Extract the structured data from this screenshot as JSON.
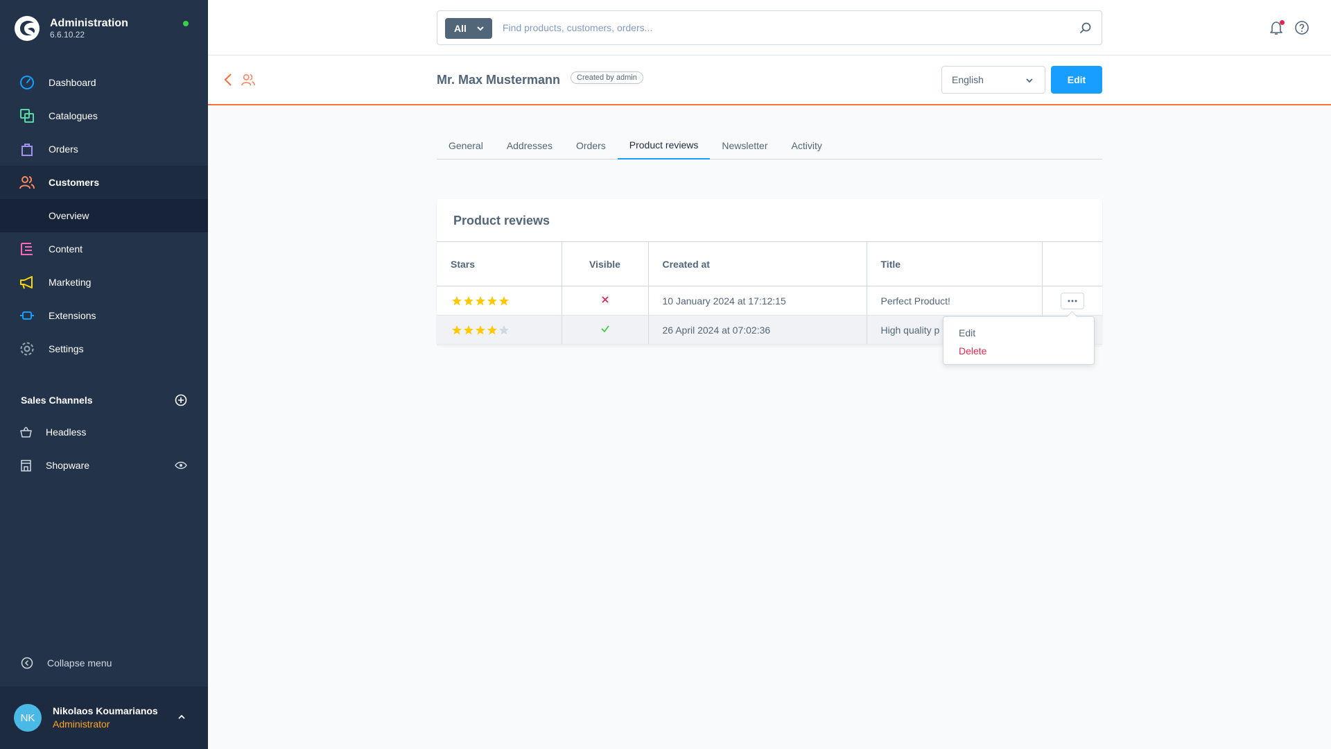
{
  "sidebar": {
    "app_title": "Administration",
    "version": "6.6.10.22",
    "items": [
      {
        "label": "Dashboard",
        "icon": "dashboard-icon"
      },
      {
        "label": "Catalogues",
        "icon": "catalogue-icon"
      },
      {
        "label": "Orders",
        "icon": "orders-icon"
      },
      {
        "label": "Customers",
        "icon": "customers-icon",
        "active": true
      },
      {
        "label": "Content",
        "icon": "content-icon"
      },
      {
        "label": "Marketing",
        "icon": "marketing-icon"
      },
      {
        "label": "Extensions",
        "icon": "extensions-icon"
      },
      {
        "label": "Settings",
        "icon": "settings-icon"
      }
    ],
    "subitem": "Overview",
    "sales_channels": {
      "title": "Sales Channels",
      "items": [
        {
          "label": "Headless",
          "icon": "basket-icon"
        },
        {
          "label": "Shopware",
          "icon": "storefront-icon"
        }
      ]
    },
    "collapse_label": "Collapse menu",
    "user": {
      "initials": "NK",
      "name": "Nikolaos Koumarianos",
      "role": "Administrator"
    }
  },
  "search": {
    "scope": "All",
    "placeholder": "Find products, customers, orders..."
  },
  "header": {
    "title": "Mr. Max Mustermann",
    "badge": "Created by admin",
    "language": "English",
    "edit_label": "Edit"
  },
  "tabs": [
    "General",
    "Addresses",
    "Orders",
    "Product reviews",
    "Newsletter",
    "Activity"
  ],
  "active_tab": "Product reviews",
  "reviews": {
    "card_title": "Product reviews",
    "columns": [
      "Stars",
      "Visible",
      "Created at",
      "Title"
    ],
    "rows": [
      {
        "stars": 5,
        "visible": false,
        "created": "10 January 2024 at 17:12:15",
        "title": "Perfect Product!"
      },
      {
        "stars": 4,
        "visible": true,
        "created": "26 April 2024 at 07:02:36",
        "title": "High quality p"
      }
    ]
  },
  "context_menu": {
    "edit": "Edit",
    "delete": "Delete"
  },
  "colors": {
    "sidebar": "#233349",
    "primary": "#189eff",
    "accent": "#ff6f3c",
    "star": "#ffc800",
    "danger": "#de294c",
    "success": "#37d046"
  }
}
